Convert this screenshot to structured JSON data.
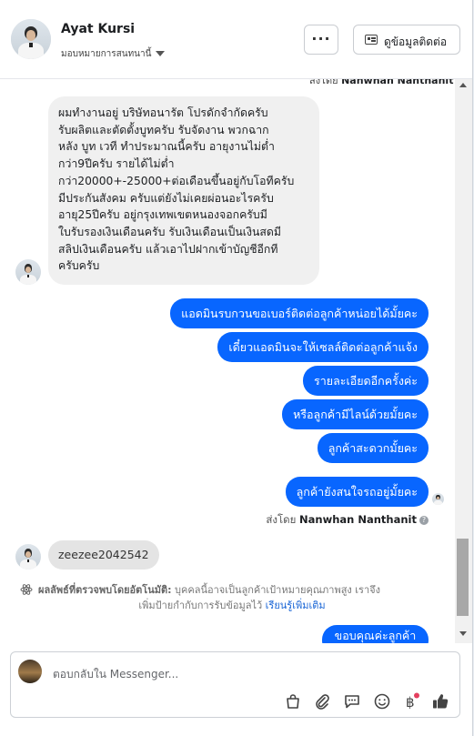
{
  "header": {
    "name": "Ayat Kursi",
    "assign_label": "มอบหมายการสนทนานี้",
    "more_label": "···",
    "contact_label": "ดูข้อมูลติดต่อ"
  },
  "conversation": {
    "top_cut_text": "ส่งโดย",
    "top_cut_name": "Nanwhan Nanthanit",
    "incoming_message": "ผมทำงานอยู่ บริษัทอนารัต โปรดักจำกัดครับ\nรับผลิตและตัดตั้งบูทครับ รับจัดงาน พวกฉาก\nหลัง บูท เวที ทำประมาณนี้ครับ อายุงานไม่ต่ำ\nกว่า9ปีครับ รายได้ไม่ต่ำ\nกว่า20000+-25000+ต่อเดือนขึ้นอยู่กับโอทีครับ\nมีประกันสังคม ครับแต่ยังไม่เคยผ่อนอะไรครับ\nอายุ25ปีครับ อยู่กรุงเทพเขตหนองจอกครับมี\nใบรับรองเงินเดือนครับ รับเงินเดือนเป็นเงินสดมี\nสลิปเงินเดือนครับ แล้วเอาไปฝากเข้าบัญชีอีกที\nครับครับ",
    "outgoing": [
      "แอดมินรบกวนขอเบอร์ติดต่อลูกค้าหน่อยได้มั้ยคะ",
      "เดี๋ยวแอดมินจะให้เซลล์ติดต่อลูกค้าแจ้ง",
      "รายละเอียดอีกครั้งค่ะ",
      "หรือลูกค้ามีไลน์ด้วยมั้ยคะ",
      "ลูกค้าสะดวกมั้ยคะ",
      "ลูกค้ายังสนใจรถอยู่มั้ยคะ"
    ],
    "sent_by_label": "ส่งโดย",
    "sent_by_name": "Nanwhan Nanthanit",
    "info_glyph": "?",
    "incoming_short": "zeezee2042542",
    "notice_bold": "ผลลัพธ์ที่ตรวจพบโดยอัตโนมัติ:",
    "notice_text": " บุคคลนี้อาจเป็นลูกค้าเป้าหมายคุณภาพสูง เราจึง",
    "notice_text2": "เพิ่มป้ายกำกับการรับข้อมูลไว้ ",
    "notice_link": "เรียนรู้เพิ่มเติม",
    "cut_bubble": "ขอบคุณค่ะลูกค้า"
  },
  "reply": {
    "placeholder": "ตอบกลับใน Messenger..."
  },
  "toolbar": {
    "icons": [
      "shopping-bag-icon",
      "paperclip-icon",
      "saved-reply-icon",
      "emoji-icon",
      "payment-icon",
      "thumbs-up-icon"
    ]
  },
  "colors": {
    "accent": "#0866ff",
    "incoming_bubble": "#f0f0f0",
    "link": "#1a66d6",
    "notification_dot": "#e4405f"
  }
}
